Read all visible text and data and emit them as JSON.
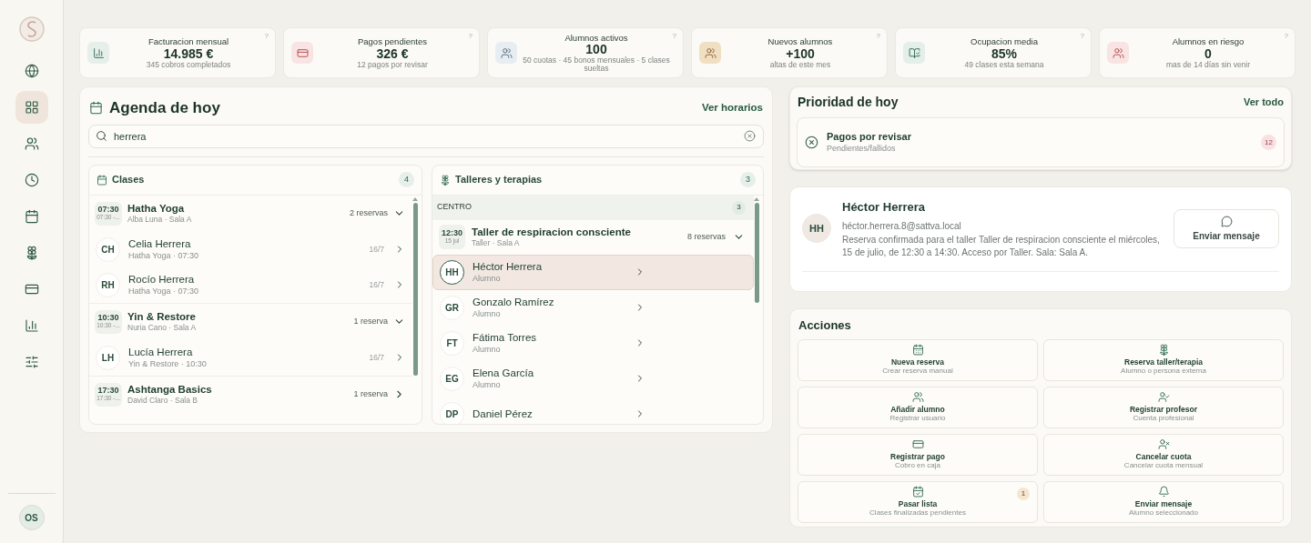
{
  "sidebar": {
    "items": [
      {
        "selected": false
      },
      {
        "selected": true
      },
      {
        "selected": false
      },
      {
        "selected": false
      },
      {
        "selected": false
      },
      {
        "selected": false
      },
      {
        "selected": false
      },
      {
        "selected": false
      },
      {
        "selected": false
      }
    ],
    "user_initials": "OS"
  },
  "stats": [
    {
      "label": "Facturacion mensual",
      "value": "14.985 €",
      "sub": "345 cobros completados",
      "color": "#e6efe9"
    },
    {
      "label": "Pagos pendientes",
      "value": "326 €",
      "sub": "12 pagos por revisar",
      "color": "#f8e4e2"
    },
    {
      "label": "Alumnos activos",
      "value": "100",
      "sub": "50 cuotas · 45 bonos mensuales · 5 clases sueltas",
      "color": "#e7edf2"
    },
    {
      "label": "Nuevos alumnos",
      "value": "+100",
      "sub": "altas de este mes",
      "color": "#f1dfc4"
    },
    {
      "label": "Ocupacion media",
      "value": "85%",
      "sub": "49 clases esta semana",
      "color": "#e3efe8"
    },
    {
      "label": "Alumnos en riesgo",
      "value": "0",
      "sub": "mas de 14 días sin venir",
      "color": "#f8e4e2"
    }
  ],
  "help_mark": "?",
  "agenda": {
    "title": "Agenda de hoy",
    "link": "Ver horarios",
    "search": {
      "value": "herrera"
    },
    "classes": {
      "title": "Clases",
      "count": "4",
      "groups": [
        {
          "time": "07:30",
          "time_sub": "07:30 -...",
          "name": "Hatha Yoga",
          "meta": "Alba Luna · Sala A",
          "reservas": "2 reservas",
          "expanded": true,
          "members": [
            {
              "initials": "CH",
              "name": "Celia Herrera",
              "meta": "Hatha Yoga · 07:30",
              "date": "16/7"
            },
            {
              "initials": "RH",
              "name": "Rocío Herrera",
              "meta": "Hatha Yoga · 07:30",
              "date": "16/7"
            }
          ]
        },
        {
          "time": "10:30",
          "time_sub": "10:30 -...",
          "name": "Yin & Restore",
          "meta": "Nuria Cano · Sala A",
          "reservas": "1 reserva",
          "expanded": true,
          "members": [
            {
              "initials": "LH",
              "name": "Lucía Herrera",
              "meta": "Yin & Restore · 10:30",
              "date": "16/7"
            }
          ]
        },
        {
          "time": "17:30",
          "time_sub": "17:30 -...",
          "name": "Ashtanga Basics",
          "meta": "David Claro · Sala B",
          "reservas": "1 reserva",
          "expanded": false
        }
      ]
    },
    "workshops": {
      "title": "Talleres y terapias",
      "count": "3",
      "section": {
        "label": "CENTRO",
        "count": "3"
      },
      "sessions": [
        {
          "time": "12:30",
          "date": "15 jul",
          "name": "Taller de respiracion consciente",
          "meta": "Taller · Sala A",
          "reservas": "8 reservas",
          "expanded": true,
          "members": [
            {
              "initials": "HH",
              "name": "Héctor Herrera",
              "role": "Alumno",
              "selected": true
            },
            {
              "initials": "GR",
              "name": "Gonzalo Ramírez",
              "role": "Alumno",
              "selected": false
            },
            {
              "initials": "FT",
              "name": "Fátima Torres",
              "role": "Alumno",
              "selected": false
            },
            {
              "initials": "EG",
              "name": "Elena García",
              "role": "Alumno",
              "selected": false
            },
            {
              "initials": "DP",
              "name": "Daniel Pérez",
              "selected": false
            }
          ]
        }
      ]
    }
  },
  "priority": {
    "title": "Prioridad de hoy",
    "link": "Ver todo",
    "items": [
      {
        "title": "Pagos por revisar",
        "sub": "Pendientes/fallidos",
        "count": "12"
      }
    ]
  },
  "contact": {
    "initials": "HH",
    "name": "Héctor Herrera",
    "email": "héctor.herrera.8@sattva.local",
    "message": "Reserva confirmada para el taller Taller de respiracion consciente el miércoles, 15 de julio, de 12:30 a 14:30. Acceso por Taller. Sala: Sala A.",
    "button": "Enviar mensaje"
  },
  "actions": {
    "title": "Acciones",
    "items": [
      {
        "title": "Nueva reserva",
        "sub": "Crear reserva manual"
      },
      {
        "title": "Reserva taller/terapia",
        "sub": "Alumno o persona externa"
      },
      {
        "title": "Añadir alumno",
        "sub": "Registrar usuario"
      },
      {
        "title": "Registrar profesor",
        "sub": "Cuenta profesional"
      },
      {
        "title": "Registrar pago",
        "sub": "Cobro en caja"
      },
      {
        "title": "Cancelar cuota",
        "sub": "Cancelar cuota mensual"
      },
      {
        "title": "Pasar lista",
        "sub": "Clases finalizadas pendientes",
        "badge": "1"
      },
      {
        "title": "Enviar mensaje",
        "sub": "Alumno seleccionado"
      }
    ]
  }
}
